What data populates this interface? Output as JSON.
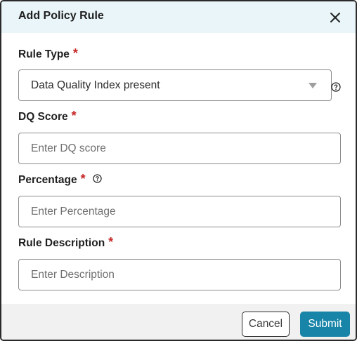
{
  "dialog": {
    "title": "Add Policy Rule",
    "close_icon": "close-icon"
  },
  "form": {
    "rule_type": {
      "label": "Rule Type",
      "required_mark": "*",
      "value": "Data Quality Index present",
      "help_icon": "question-circle-icon"
    },
    "dq_score": {
      "label": "DQ Score",
      "required_mark": "*",
      "placeholder": "Enter DQ score"
    },
    "percentage": {
      "label": "Percentage",
      "required_mark": "*",
      "placeholder": "Enter Percentage",
      "help_icon": "question-circle-icon"
    },
    "rule_description": {
      "label": "Rule Description",
      "required_mark": "*",
      "placeholder": "Enter Description"
    }
  },
  "footer": {
    "cancel_label": "Cancel",
    "submit_label": "Submit"
  },
  "colors": {
    "header_bg": "#e9f5f9",
    "required": "#c62828",
    "primary": "#1784a8",
    "footer_bg": "#f1f1f1"
  }
}
